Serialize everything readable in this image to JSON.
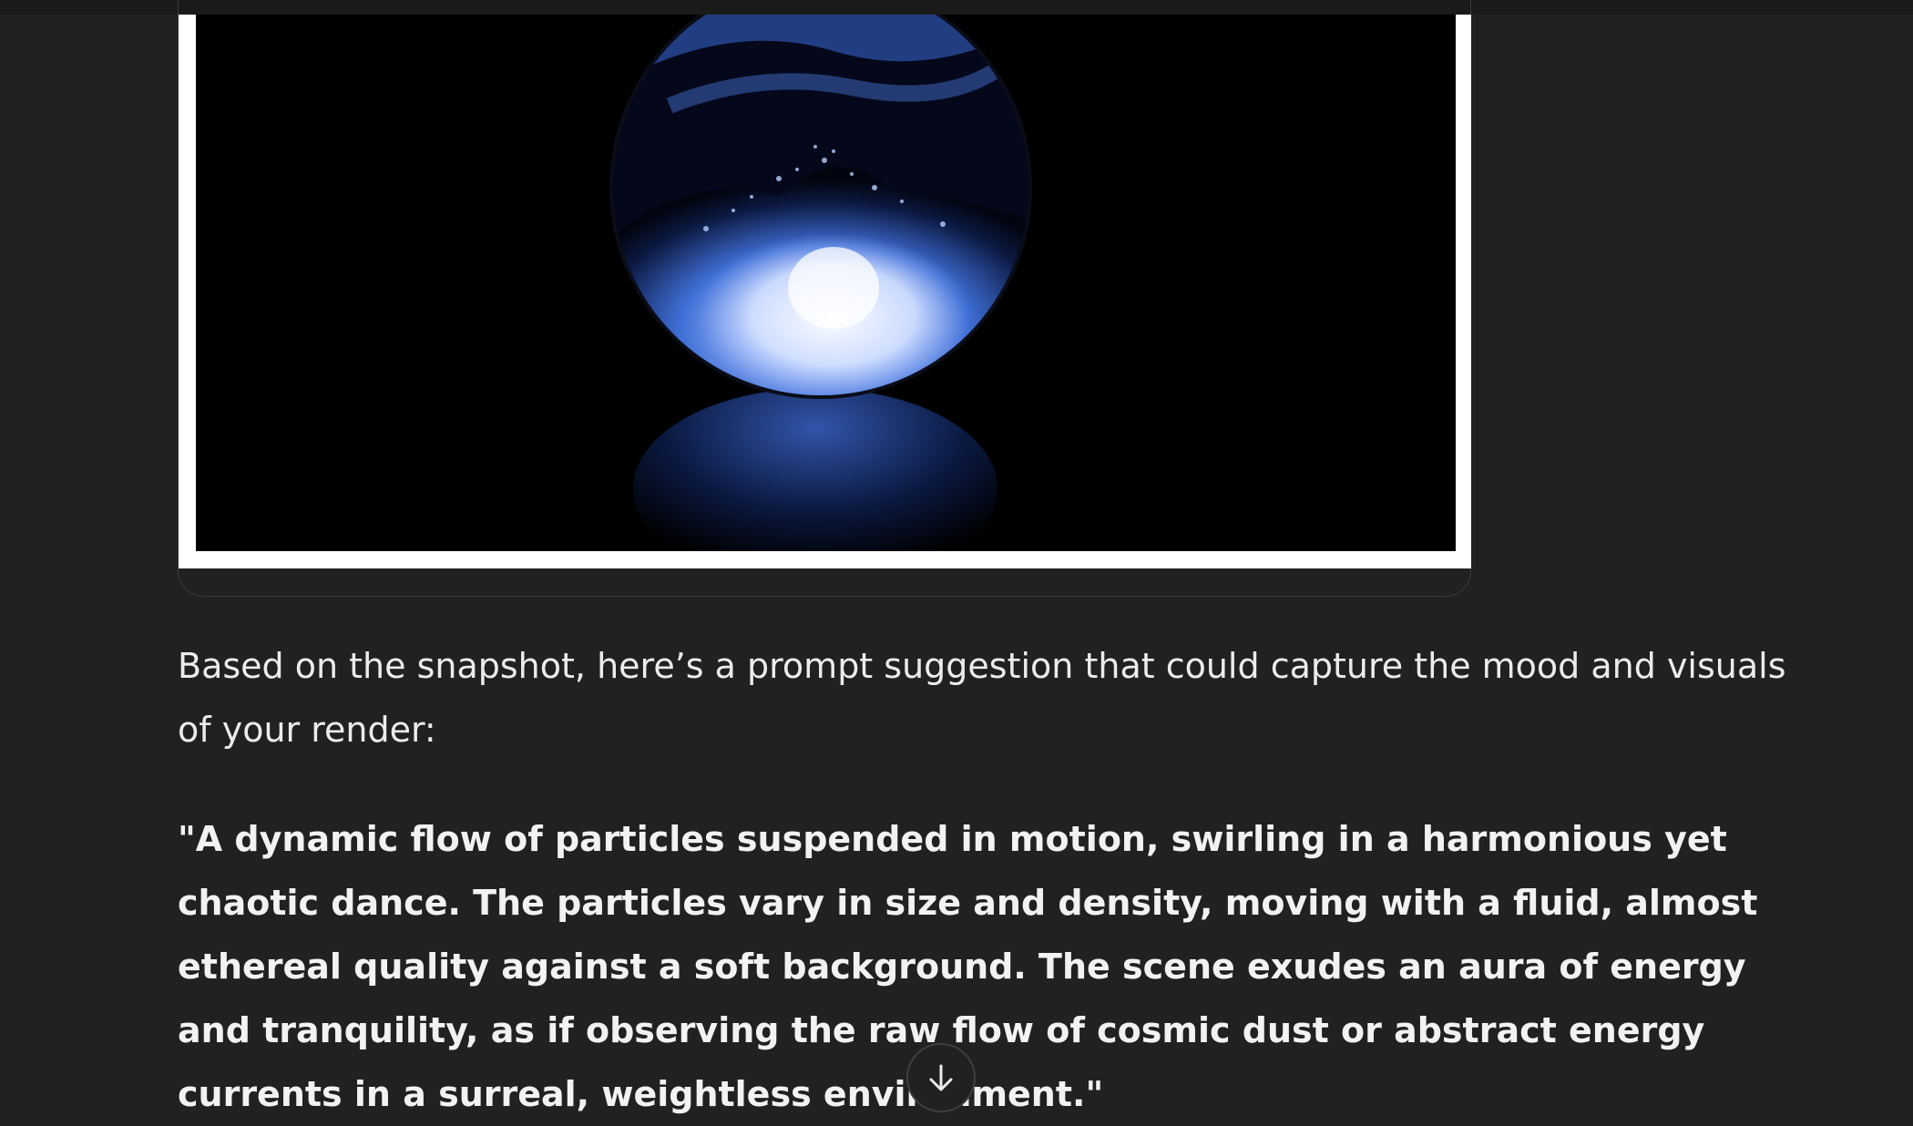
{
  "conversation": {
    "image": {
      "subject_icon": "glowing-blue-particle-sphere"
    },
    "response": {
      "intro": "Based on the snapshot, here’s a prompt suggestion that could capture the mood and visuals of your render:",
      "prompt_quote": "\"A dynamic flow of particles suspended in motion, swirling in a harmonious yet chaotic dance. The particles vary in size and density, moving with a fluid, almost ethereal quality against a soft background. The scene exudes an aura of energy and tranquility, as if observing the raw flow of cosmic dust or abstract energy currents in a surreal, weightless environment.\""
    },
    "scroll_button": {
      "icon": "arrow-down-icon"
    }
  },
  "colors": {
    "background": "#212121",
    "text": "#ececec",
    "image_frame": "#ffffff",
    "particle_blue": "#5b8cff"
  }
}
